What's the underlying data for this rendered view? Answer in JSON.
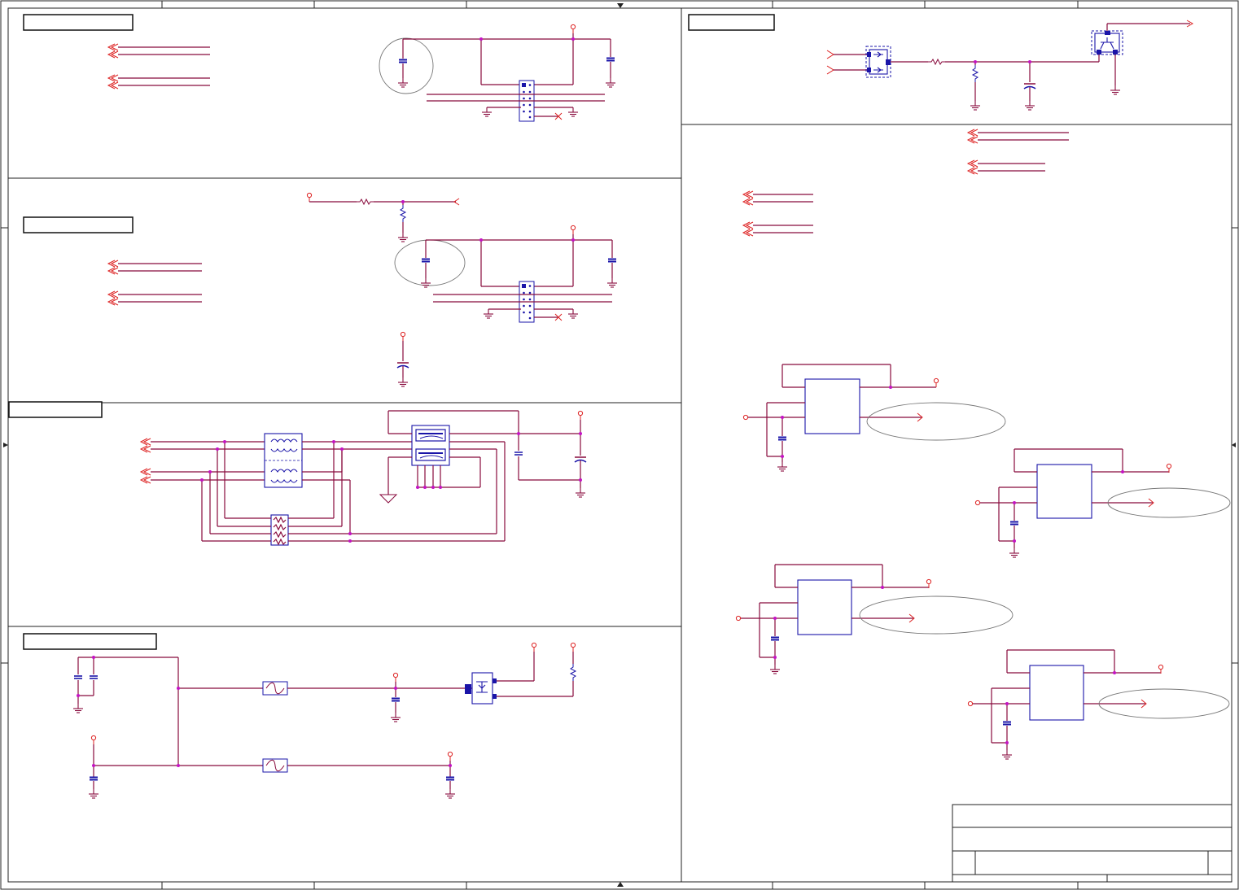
{
  "title": "",
  "sheet": {
    "colors": {
      "wire": "#880a3c",
      "component": "#1a14a8",
      "power_port": "#dd2222",
      "junction": "#c414c4",
      "border": "#222222"
    }
  },
  "panels": [
    {
      "id": "top-left",
      "heading": ""
    },
    {
      "id": "mid-left",
      "heading": ""
    },
    {
      "id": "usb",
      "heading": ""
    },
    {
      "id": "power",
      "heading": ""
    },
    {
      "id": "top-right",
      "heading": ""
    }
  ],
  "icons": {
    "ground": "ground-icon",
    "power_port": "power-port-icon",
    "net_label": "net-label-arrow-icon",
    "resistor": "resistor-icon",
    "capacitor": "capacitor-icon",
    "fuse": "fuse-icon",
    "mosfet": "mosfet-icon",
    "header": "pin-header-icon",
    "transformer": "transformer-icon",
    "usb": "usb-connector-icon",
    "ic": "ic-block-icon"
  },
  "title_block": {
    "title": "",
    "size": "",
    "number": "",
    "rev": "",
    "date": "",
    "sheet": ""
  }
}
